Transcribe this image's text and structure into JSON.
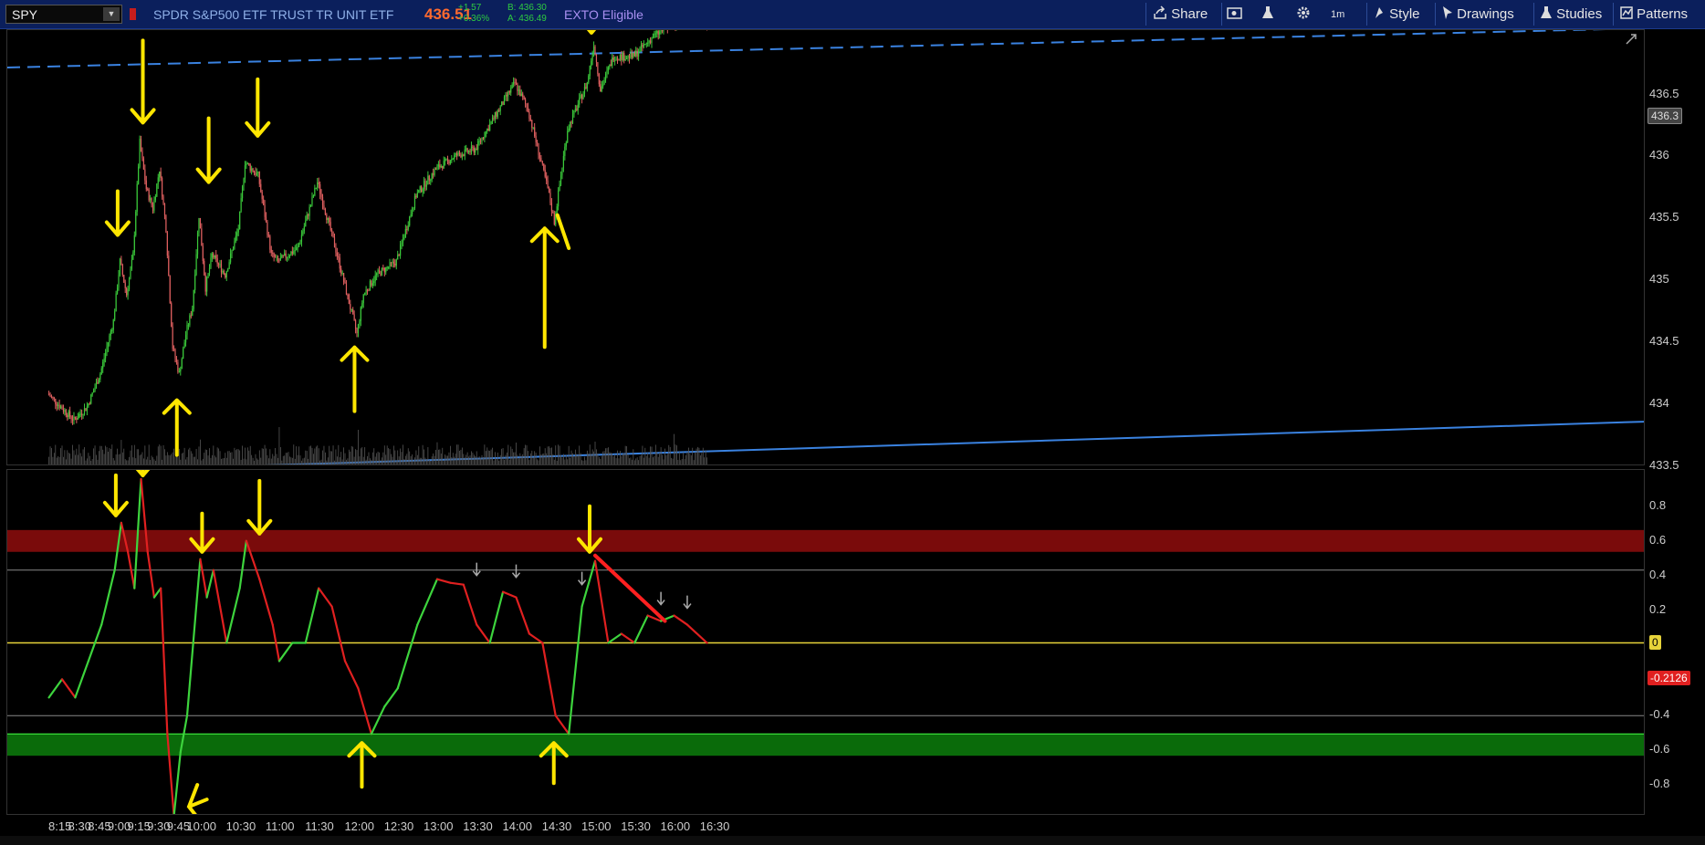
{
  "toolbar": {
    "symbol": "SPY",
    "dropdown_glyph": "▼",
    "description": "SPDR S&P500 ETF TRUST TR UNIT ETF",
    "last_price": "436.51",
    "change_abs": "+1.57",
    "change_pct": "+0.36%",
    "bid": "B: 436.30",
    "ask": "A: 436.49",
    "exto": "EXTO Eligible",
    "buttons": {
      "share": "Share",
      "timeframe": "1m",
      "style": "Style",
      "drawings": "Drawings",
      "studies": "Studies",
      "patterns": "Patterns"
    },
    "icons": [
      "share-icon",
      "screenshot-icon",
      "flask-icon",
      "gear-icon",
      "timeframe-icon",
      "style-icon",
      "cursor-icon",
      "studies-flask-icon",
      "patterns-icon",
      "expand-icon"
    ]
  },
  "colors": {
    "bull": "#3ac83a",
    "bear": "#e06060",
    "annotation": "#ffe600",
    "trend_blue": "#3a82e0",
    "osc_green": "#3dd43d",
    "osc_red": "#e02020",
    "zero_line": "#e6d33a",
    "ob_band": "#7a0b0b",
    "os_band": "#0a6b0a"
  },
  "price_axis": {
    "ticks": [
      "436.5",
      "436",
      "435.5",
      "435",
      "434.5",
      "434",
      "433.5"
    ],
    "current_badge": "436.3"
  },
  "osc_axis": {
    "ticks": [
      "0.8",
      "0.6",
      "0.4",
      "0.2",
      "0",
      "-0.4",
      "-0.6",
      "-0.8"
    ],
    "zero_badge": "0",
    "value_badge": "-0.2126"
  },
  "time_axis": [
    "8:15",
    "8:30",
    "8:45",
    "9:00",
    "9:15",
    "9:30",
    "9:45",
    "10:00",
    "10:30",
    "11:00",
    "11:30",
    "12:00",
    "12:30",
    "13:00",
    "13:30",
    "14:00",
    "14:30",
    "15:00",
    "15:30",
    "16:00",
    "16:30"
  ],
  "chart_data": {
    "type": "line",
    "price_series": {
      "name": "SPY",
      "x": [
        "8:05",
        "8:15",
        "8:25",
        "8:35",
        "8:45",
        "8:55",
        "9:00",
        "9:05",
        "9:10",
        "9:15",
        "9:20",
        "9:25",
        "9:30",
        "9:35",
        "9:40",
        "9:45",
        "9:50",
        "9:55",
        "10:00",
        "10:05",
        "10:10",
        "10:20",
        "10:30",
        "10:35",
        "10:45",
        "10:55",
        "11:00",
        "11:15",
        "11:30",
        "11:45",
        "12:00",
        "12:05",
        "12:15",
        "12:30",
        "12:45",
        "13:00",
        "13:15",
        "13:30",
        "13:45",
        "14:00",
        "14:10",
        "14:25",
        "14:30",
        "14:40",
        "14:55",
        "15:00",
        "15:05",
        "15:15",
        "15:30",
        "15:45",
        "16:00",
        "16:15",
        "16:25"
      ],
      "y": [
        434.05,
        433.95,
        433.85,
        433.95,
        434.2,
        434.6,
        435.05,
        434.8,
        435.1,
        435.95,
        435.6,
        435.45,
        435.75,
        435.3,
        434.4,
        434.2,
        434.5,
        434.7,
        435.4,
        434.85,
        435.1,
        434.95,
        435.3,
        435.8,
        435.7,
        435.1,
        435.05,
        435.15,
        435.65,
        435.1,
        434.5,
        434.8,
        434.95,
        435.05,
        435.55,
        435.75,
        435.85,
        435.9,
        436.15,
        436.4,
        436.2,
        435.6,
        435.35,
        436.05,
        436.4,
        436.7,
        436.35,
        436.6,
        436.6,
        436.75,
        436.85,
        436.9,
        436.85
      ]
    },
    "price_ylim": [
      433.5,
      436.8
    ],
    "oscillator": {
      "x": [
        "8:05",
        "8:15",
        "8:25",
        "8:35",
        "8:45",
        "8:55",
        "9:00",
        "9:05",
        "9:10",
        "9:15",
        "9:20",
        "9:25",
        "9:30",
        "9:35",
        "9:40",
        "9:45",
        "9:50",
        "10:00",
        "10:05",
        "10:10",
        "10:15",
        "10:20",
        "10:30",
        "10:35",
        "10:45",
        "10:55",
        "11:00",
        "11:10",
        "11:20",
        "11:30",
        "11:40",
        "11:50",
        "12:00",
        "12:10",
        "12:20",
        "12:30",
        "12:45",
        "13:00",
        "13:10",
        "13:20",
        "13:30",
        "13:40",
        "13:50",
        "14:00",
        "14:10",
        "14:20",
        "14:30",
        "14:40",
        "14:50",
        "15:00",
        "15:10",
        "15:20",
        "15:30",
        "15:40",
        "15:50",
        "16:00",
        "16:10",
        "16:25"
      ],
      "y": [
        -0.3,
        -0.2,
        -0.3,
        -0.1,
        0.1,
        0.4,
        0.66,
        0.5,
        0.3,
        0.9,
        0.5,
        0.25,
        0.3,
        -0.5,
        -0.95,
        -0.6,
        -0.4,
        0.46,
        0.25,
        0.4,
        0.2,
        0.0,
        0.3,
        0.56,
        0.35,
        0.1,
        -0.1,
        0.0,
        0.0,
        0.3,
        0.2,
        -0.1,
        -0.25,
        -0.5,
        -0.35,
        -0.25,
        0.1,
        0.35,
        0.33,
        0.32,
        0.1,
        0.0,
        0.28,
        0.25,
        0.05,
        0.0,
        -0.4,
        -0.5,
        0.2,
        0.45,
        0.0,
        0.05,
        0.0,
        0.15,
        0.12,
        0.15,
        0.1,
        0.0
      ],
      "overbought_band": [
        0.5,
        0.62
      ],
      "oversold_band": [
        -0.62,
        -0.5
      ],
      "levels": [
        0.4,
        0,
        -0.4
      ]
    },
    "osc_ylim": [
      -0.95,
      0.95
    ],
    "grid": false
  }
}
